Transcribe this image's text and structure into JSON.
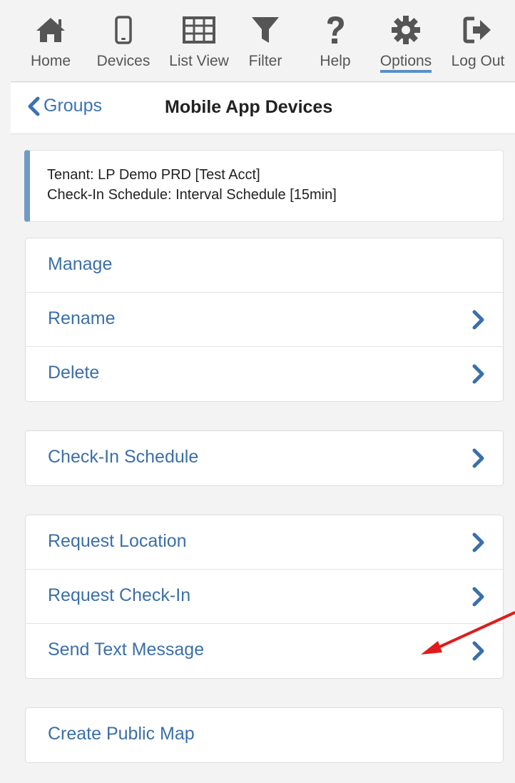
{
  "toolbar": {
    "items": [
      {
        "label": "Home",
        "icon": "home-icon"
      },
      {
        "label": "Devices",
        "icon": "mobile-icon"
      },
      {
        "label": "List View",
        "icon": "grid-icon"
      },
      {
        "label": "Filter",
        "icon": "filter-icon"
      },
      {
        "label": "Help",
        "icon": "question-icon"
      },
      {
        "label": "Options",
        "icon": "gear-icon",
        "active": true
      },
      {
        "label": "Log Out",
        "icon": "sign-out-icon"
      }
    ]
  },
  "header": {
    "back_label": "Groups",
    "title": "Mobile App Devices"
  },
  "info": {
    "tenant": "Tenant: LP Demo PRD [Test Acct]",
    "schedule": "Check-In Schedule: Interval Schedule [15min]"
  },
  "groups": [
    {
      "items": [
        {
          "label": "Manage",
          "chevron": false
        },
        {
          "label": "Rename",
          "chevron": true
        },
        {
          "label": "Delete",
          "chevron": true
        }
      ]
    },
    {
      "items": [
        {
          "label": "Check-In Schedule",
          "chevron": true
        }
      ]
    },
    {
      "items": [
        {
          "label": "Request Location",
          "chevron": true
        },
        {
          "label": "Request Check-In",
          "chevron": true
        },
        {
          "label": "Send Text Message",
          "chevron": true
        }
      ]
    },
    {
      "items": [
        {
          "label": "Create Public Map",
          "chevron": false
        }
      ]
    }
  ],
  "colors": {
    "link": "#3b6fa8",
    "accent": "#5b8fc7",
    "icon": "#555555",
    "annotation_arrow": "#e01b1b"
  }
}
